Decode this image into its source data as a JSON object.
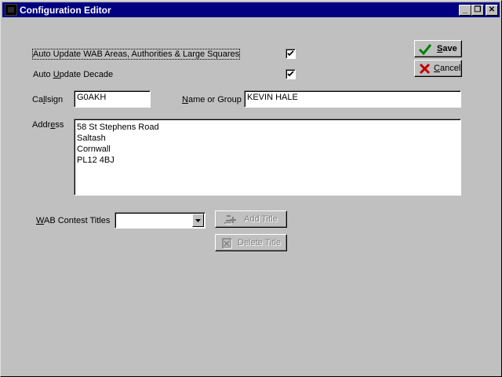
{
  "window": {
    "title": "Configuration Editor",
    "controls": {
      "minimize": "_",
      "restore": "❐",
      "close": "✕"
    }
  },
  "options": {
    "auto_update_wab": {
      "label": "Auto Update WAB Areas, Authorities & Large Squares",
      "checked": true
    },
    "auto_update_decade": {
      "label_pre": "Auto ",
      "label_u": "U",
      "label_post": "pdate Decade",
      "checked": true
    }
  },
  "callsign": {
    "label_pre": "Ca",
    "label_u": "l",
    "label_post": "lsign",
    "value": "G0AKH"
  },
  "name_group": {
    "label_u": "N",
    "label_post": "ame or Group",
    "value": "KEVIN HALE"
  },
  "address": {
    "label_pre": "Addr",
    "label_u": "e",
    "label_post": "ss",
    "lines": [
      "58 St Stephens Road",
      "Saltash",
      "Cornwall",
      "PL12 4BJ"
    ]
  },
  "wab_contest": {
    "label_u": "W",
    "label_post": "AB Contest Titles",
    "selected": ""
  },
  "buttons": {
    "save": {
      "label_u": "S",
      "label_post": "ave"
    },
    "cancel": {
      "label_u": "C",
      "label_post": "ancel"
    },
    "add_title": {
      "label": "Add Title"
    },
    "delete_title": {
      "label": "Delete Title"
    }
  },
  "colors": {
    "titlebar": "#000080",
    "face": "#c0c0c0",
    "save_check": "#008000",
    "cancel_x": "#c00000"
  }
}
